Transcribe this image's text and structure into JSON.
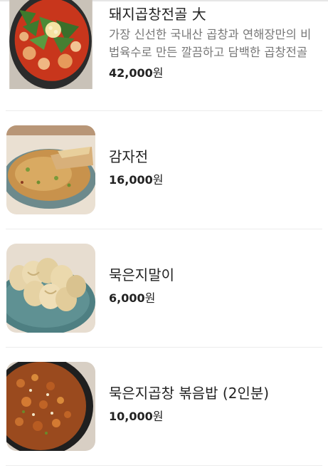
{
  "menu": {
    "items": [
      {
        "name": "돼지곱창전골 大",
        "description": "가장 신선한 국내산 곱창과 연해장만의 비법육수로 만든 깔끔하고 담백한 곱창전골",
        "price": "42,000",
        "currency": "원",
        "image": "gopchang-hotpot-photo"
      },
      {
        "name": "감자전",
        "description": "",
        "price": "16,000",
        "currency": "원",
        "image": "potato-pancake-photo"
      },
      {
        "name": "묵은지말이",
        "description": "",
        "price": "6,000",
        "currency": "원",
        "image": "kimchi-roll-photo"
      },
      {
        "name": "묵은지곱창 볶음밥 (2인분)",
        "description": "",
        "price": "10,000",
        "currency": "원",
        "image": "fried-rice-photo"
      }
    ]
  }
}
